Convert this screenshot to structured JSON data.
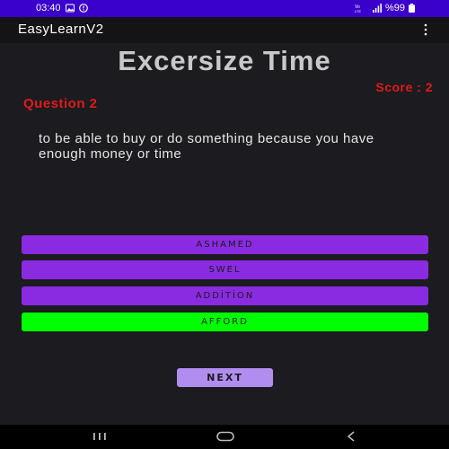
{
  "status_bar": {
    "time": "03:40",
    "battery": "%99",
    "network": "VoLTE",
    "icons": [
      "image-icon",
      "notification-icon",
      "signal-icon",
      "battery-icon"
    ]
  },
  "app_bar": {
    "title": "EasyLearnV2",
    "menu_icon": "overflow-menu-icon"
  },
  "main": {
    "heading": "Excersize Time",
    "score": "Score : 2",
    "question_number": "Question 2",
    "question_text": "to be able to buy or do something because you have enough money or time",
    "options": [
      {
        "label": "ASHAMED"
      },
      {
        "label": "SWEL"
      },
      {
        "label": "ADDİTİON"
      },
      {
        "label": "AFFORD"
      }
    ],
    "next_label": "NEXT"
  },
  "nav_bar": {
    "buttons": [
      "recents-icon",
      "home-icon",
      "back-icon"
    ]
  },
  "colors": {
    "background": "#1c1b1f",
    "status_bar": "#3a00cc",
    "option": "#8a2be2",
    "correct_option": "#00ff00",
    "next_button": "#b18df0",
    "score_text": "#e01b1b"
  }
}
